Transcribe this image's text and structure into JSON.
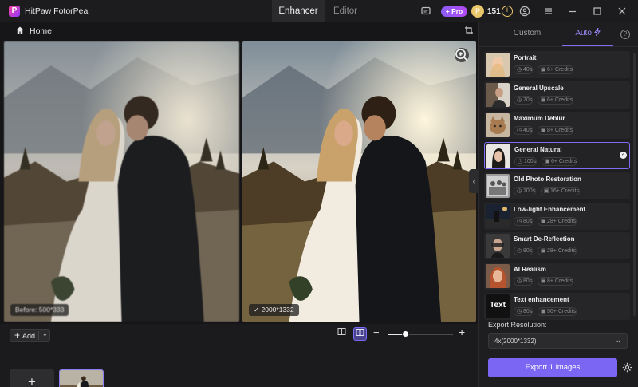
{
  "app": {
    "title": "HitPaw FotorPea",
    "logo_letter": "P"
  },
  "mode_tabs": [
    {
      "label": "Enhancer",
      "active": true
    },
    {
      "label": "Editor",
      "active": false
    }
  ],
  "titlebar": {
    "pro_label": "+ Pro",
    "credits": "151"
  },
  "breadcrumb": {
    "home_label": "Home"
  },
  "preview": {
    "before_label": "Before: 500*333",
    "after_label": "2000*1332"
  },
  "toolbar": {
    "add_label": "Add",
    "zoom_level": 0.27
  },
  "panel": {
    "tabs": [
      {
        "label": "Custom",
        "active": false
      },
      {
        "label": "Auto",
        "active": true
      }
    ],
    "presets": [
      {
        "name": "Portrait",
        "time": "40s",
        "credits": "6+ Credits",
        "thumb": "portrait",
        "selected": false
      },
      {
        "name": "General Upscale",
        "time": "70s",
        "credits": "6+ Credits",
        "thumb": "upscale",
        "selected": false
      },
      {
        "name": "Maximum Deblur",
        "time": "40s",
        "credits": "8+ Credits",
        "thumb": "cat",
        "selected": false
      },
      {
        "name": "General Natural",
        "time": "100s",
        "credits": "6+ Credits",
        "thumb": "natural",
        "selected": true
      },
      {
        "name": "Old Photo Restoration",
        "time": "100s",
        "credits": "16+ Credits",
        "thumb": "old-photo",
        "selected": false
      },
      {
        "name": "Low-light Enhancement",
        "time": "80s",
        "credits": "28+ Credits",
        "thumb": "lowlight",
        "selected": false
      },
      {
        "name": "Smart De-Reflection",
        "time": "80s",
        "credits": "28+ Credits",
        "thumb": "reflection",
        "selected": false
      },
      {
        "name": "AI Realism",
        "time": "80s",
        "credits": "8+ Credits",
        "thumb": "realism",
        "selected": false
      },
      {
        "name": "Text enhancement",
        "time": "80s",
        "credits": "50+ Credits",
        "thumb": "text",
        "selected": false,
        "thumb_text": "Text"
      }
    ],
    "export_resolution_label": "Export Resolution:",
    "export_resolution_value": "4x(2000*1332)",
    "export_button": "Export 1 images"
  }
}
